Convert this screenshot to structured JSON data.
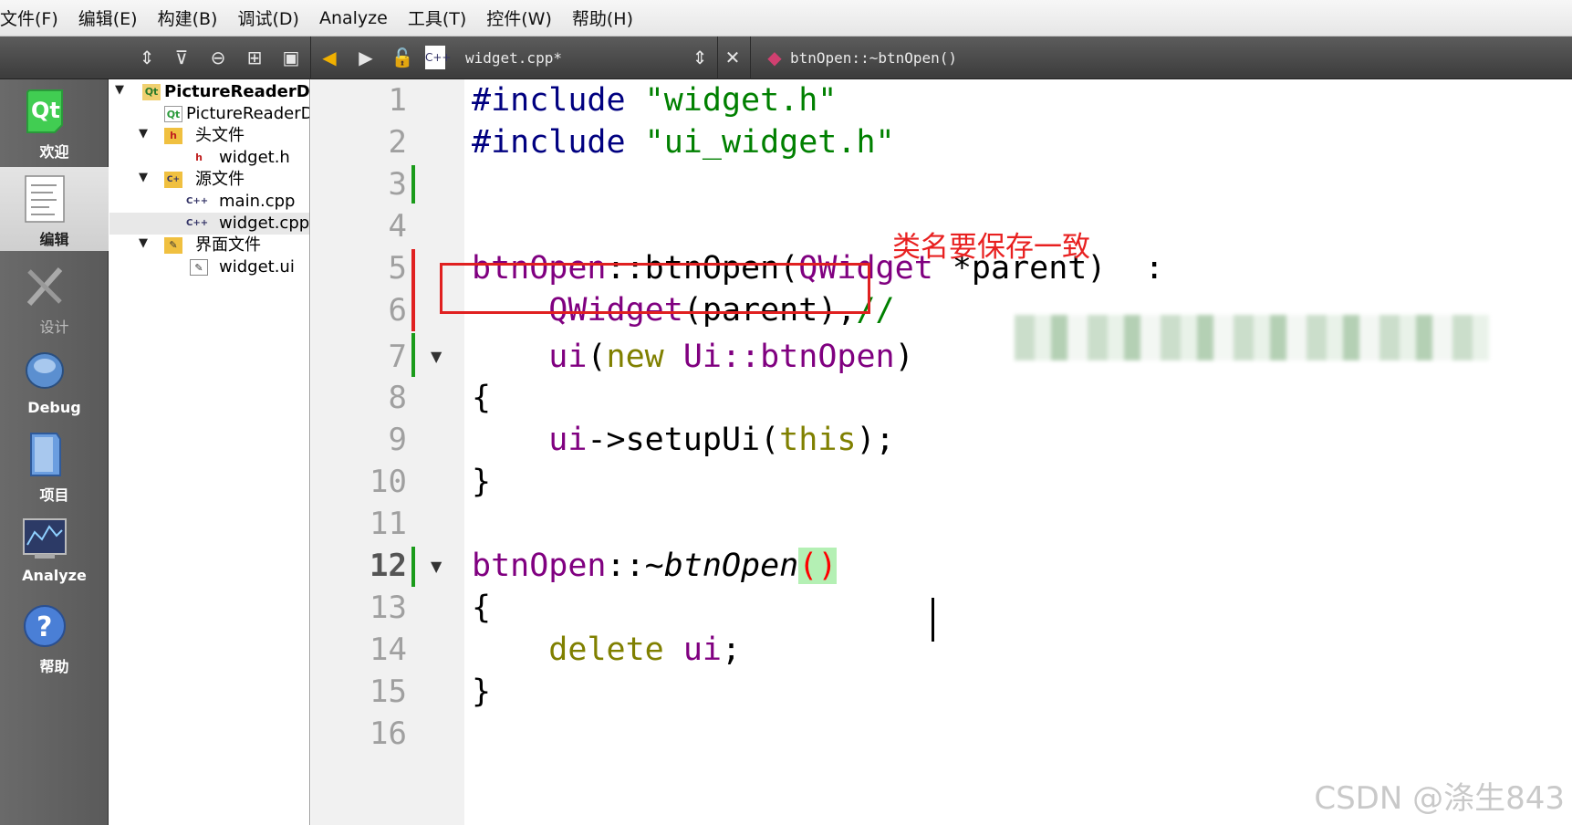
{
  "menu": [
    "文件(F)",
    "编辑(E)",
    "构建(B)",
    "调试(D)",
    "Analyze",
    "工具(T)",
    "控件(W)",
    "帮助(H)"
  ],
  "toolbar": {
    "file_name": "widget.cpp*",
    "symbol": "btnOpen::~btnOpen()"
  },
  "modes": [
    {
      "label": "欢迎",
      "icon": "qt-logo-icon"
    },
    {
      "label": "编辑",
      "icon": "edit-document-icon"
    },
    {
      "label": "设计",
      "icon": "design-tools-icon"
    },
    {
      "label": "Debug",
      "icon": "debug-bug-icon"
    },
    {
      "label": "项目",
      "icon": "project-folder-icon"
    },
    {
      "label": "Analyze",
      "icon": "analyze-monitor-icon"
    },
    {
      "label": "帮助",
      "icon": "help-question-icon"
    }
  ],
  "tree": [
    {
      "text": "PictureReaderDe",
      "bold": true
    },
    {
      "text": "PictureReaderD"
    },
    {
      "text": "头文件"
    },
    {
      "text": "widget.h"
    },
    {
      "text": "源文件"
    },
    {
      "text": "main.cpp"
    },
    {
      "text": "widget.cpp"
    },
    {
      "text": "界面文件"
    },
    {
      "text": "widget.ui"
    }
  ],
  "editor": {
    "line_numbers": [
      "1",
      "2",
      "3",
      "4",
      "5",
      "6",
      "7",
      "8",
      "9",
      "10",
      "11",
      "12",
      "13",
      "14",
      "15",
      "16"
    ],
    "current_line": "12",
    "code": {
      "l1_pre": "#include",
      "l1_str": "\"widget.h\"",
      "l2_pre": "#include",
      "l2_str": "\"ui_widget.h\"",
      "l5_cls": "btnOpen",
      "l5_sep": "::",
      "l5_ctor": "btnOpen",
      "l5_open": "(",
      "l5_type": "QWidget",
      "l5_rest": " *parent)  :",
      "l6_base": "QWidget",
      "l6_rest": "(parent),",
      "l6_cmt": "//",
      "l7_ui": "ui",
      "l7_open": "(",
      "l7_new": "new",
      "l7_ns": "Ui::btnOpen",
      "l7_close": ")",
      "l8": "{",
      "l9_ui": "ui",
      "l9_arrow": "->setupUi(",
      "l9_this": "this",
      "l9_end": ");",
      "l10": "}",
      "l12_cls": "btnOpen",
      "l12_sep": "::~",
      "l12_dtor": "btnOpen",
      "l12_parens": "()",
      "l13": "{",
      "l14_kw": "delete",
      "l14_ui": "ui",
      "l14_end": ";",
      "l15": "}"
    }
  },
  "annotation": "类名要保存一致",
  "watermark": "CSDN @涤生843",
  "colors": {
    "annotation": "#e02020",
    "change_marker_green": "#1a9b1a",
    "change_marker_red": "#e02020"
  }
}
